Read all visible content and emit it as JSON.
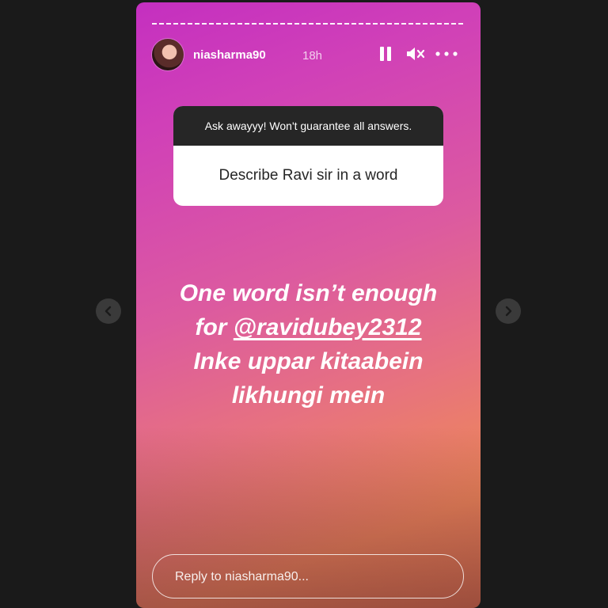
{
  "story": {
    "username": "niasharma90",
    "time": "18h",
    "question_sticker": {
      "prompt": "Ask awayyy! Won't guarantee all answers.",
      "question": "Describe Ravi sir in a word"
    },
    "answer": {
      "line1": "One word isn’t enough",
      "line2_prefix": "for ",
      "mention": "@ravidubey2312",
      "line3": "Inke uppar kitaabein",
      "line4": "likhungi mein"
    },
    "reply": {
      "placeholder": "Reply to niasharma90..."
    }
  },
  "icons": {
    "pause": "pause-icon",
    "mute": "speaker-muted-icon",
    "more": "more-options-icon",
    "prev": "chevron-left-icon",
    "next": "chevron-right-icon"
  },
  "colors": {
    "gradient_top": "#c42fc0",
    "gradient_mid": "#dc5aa0",
    "gradient_bottom": "#ee8a55",
    "sticker_header": "#262626",
    "page_background": "#1a1a1a"
  }
}
